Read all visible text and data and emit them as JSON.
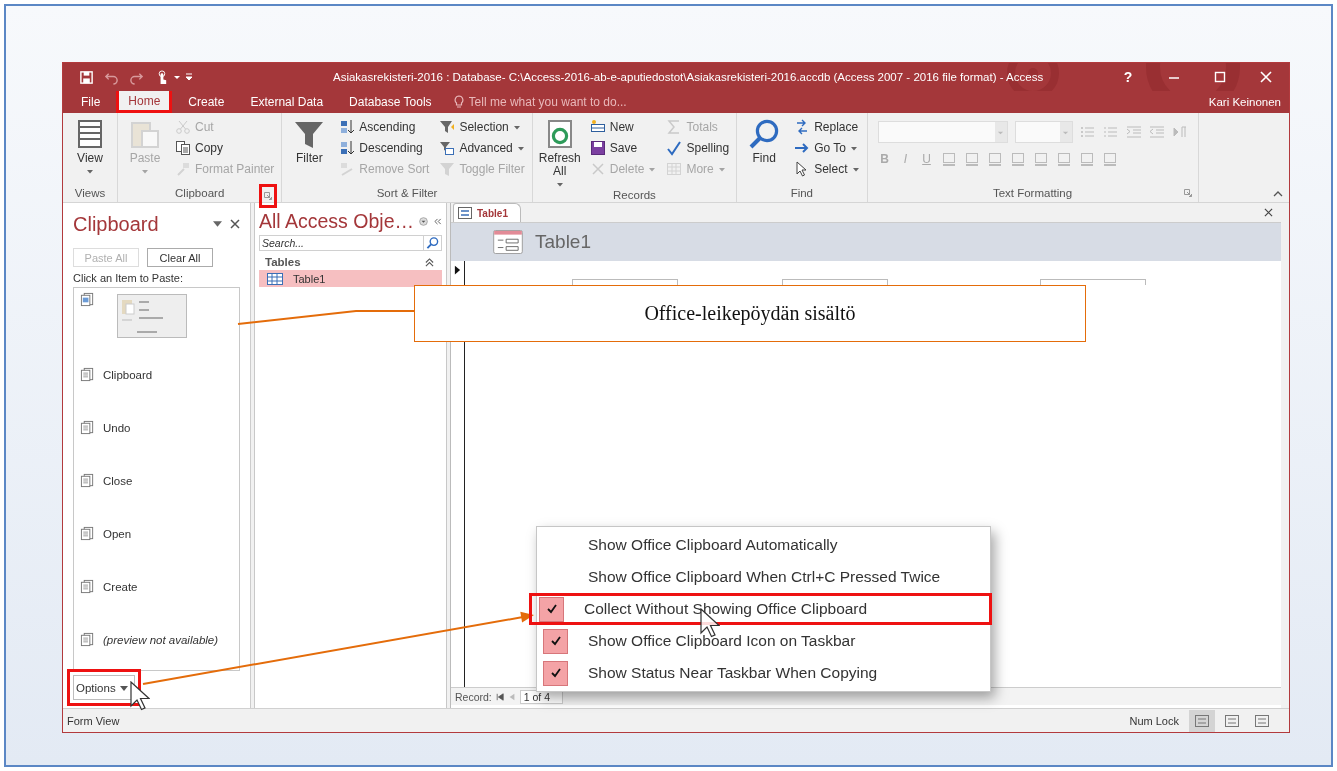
{
  "window": {
    "title": "Asiakasrekisteri-2016 : Database- C:\\Access-2016-ab-e-aputiedostot\\Asiakasrekisteri-2016.accdb (Access 2007 - 2016 file format) - Access",
    "help": "?",
    "user": "Kari Keinonen"
  },
  "ribbon_tabs": [
    {
      "label": "File",
      "selected": false,
      "highlighted": false
    },
    {
      "label": "Home",
      "selected": true,
      "highlighted": true
    },
    {
      "label": "Create",
      "selected": false,
      "highlighted": false
    },
    {
      "label": "External Data",
      "selected": false,
      "highlighted": false
    },
    {
      "label": "Database Tools",
      "selected": false,
      "highlighted": false
    }
  ],
  "tell_me": {
    "placeholder": "Tell me what you want to do..."
  },
  "ribbon_groups": [
    {
      "label": "Views",
      "kind": "commands",
      "columns": [
        [
          {
            "label": "View",
            "kind": "large",
            "dropdown": true,
            "disabled": false
          }
        ]
      ]
    },
    {
      "label": "Clipboard",
      "kind": "commands",
      "launcher": {
        "highlighted": true
      },
      "columns": [
        [
          {
            "label": "Paste",
            "kind": "large",
            "dropdown": true,
            "disabled": true
          }
        ],
        [
          {
            "label": "Cut",
            "kind": "small",
            "dropdown": false,
            "disabled": true
          },
          {
            "label": "Copy",
            "kind": "small",
            "dropdown": false,
            "disabled": false
          },
          {
            "label": "Format Painter",
            "kind": "small",
            "dropdown": false,
            "disabled": true
          }
        ]
      ]
    },
    {
      "label": "Sort & Filter",
      "kind": "commands",
      "columns": [
        [
          {
            "label": "Filter",
            "kind": "large",
            "dropdown": false,
            "disabled": false
          }
        ],
        [
          {
            "label": "Ascending",
            "kind": "small",
            "dropdown": false,
            "disabled": false
          },
          {
            "label": "Descending",
            "kind": "small",
            "dropdown": false,
            "disabled": false
          },
          {
            "label": "Remove Sort",
            "kind": "small",
            "dropdown": false,
            "disabled": true
          }
        ],
        [
          {
            "label": "Selection",
            "kind": "small",
            "dropdown": true,
            "disabled": false
          },
          {
            "label": "Advanced",
            "kind": "small",
            "dropdown": true,
            "disabled": false
          },
          {
            "label": "Toggle Filter",
            "kind": "small",
            "dropdown": false,
            "disabled": true
          }
        ]
      ]
    },
    {
      "label": "Records",
      "kind": "commands",
      "columns": [
        [
          {
            "label": "Refresh All",
            "kind": "large",
            "dropdown": true,
            "disabled": false
          }
        ],
        [
          {
            "label": "New",
            "kind": "small",
            "dropdown": false,
            "disabled": false
          },
          {
            "label": "Save",
            "kind": "small",
            "dropdown": false,
            "disabled": false
          },
          {
            "label": "Delete",
            "kind": "small",
            "dropdown": true,
            "disabled": true
          }
        ],
        [
          {
            "label": "Totals",
            "kind": "small",
            "dropdown": false,
            "disabled": true
          },
          {
            "label": "Spelling",
            "kind": "small",
            "dropdown": false,
            "disabled": false
          },
          {
            "label": "More",
            "kind": "small",
            "dropdown": true,
            "disabled": true
          }
        ]
      ]
    },
    {
      "label": "Find",
      "kind": "commands",
      "columns": [
        [
          {
            "label": "Find",
            "kind": "large",
            "dropdown": false,
            "disabled": false
          }
        ],
        [
          {
            "label": "Replace",
            "kind": "small",
            "dropdown": false,
            "disabled": false
          },
          {
            "label": "Go To",
            "kind": "small",
            "dropdown": true,
            "disabled": false
          },
          {
            "label": "Select",
            "kind": "small",
            "dropdown": true,
            "disabled": false
          }
        ]
      ]
    },
    {
      "label": "Text Formatting",
      "kind": "formatting",
      "launcher": {
        "highlighted": false
      },
      "style_buttons": [
        "B",
        "I",
        "U"
      ]
    }
  ],
  "clipboard_pane": {
    "title": "Clipboard",
    "buttons": [
      {
        "label": "Paste All",
        "disabled": true
      },
      {
        "label": "Clear All",
        "disabled": false
      }
    ],
    "hint": "Click an Item to Paste:",
    "items": [
      {
        "kind": "image"
      },
      {
        "kind": "text",
        "label": "Clipboard",
        "italic": false
      },
      {
        "kind": "text",
        "label": "Undo",
        "italic": false
      },
      {
        "kind": "text",
        "label": "Close",
        "italic": false
      },
      {
        "kind": "text",
        "label": "Open",
        "italic": false
      },
      {
        "kind": "text",
        "label": "Create",
        "italic": false
      },
      {
        "kind": "text",
        "label": "(preview not available)",
        "italic": true
      }
    ],
    "options": {
      "label": "Options",
      "highlighted": true
    }
  },
  "navigation_pane": {
    "title": "All Access Obje…",
    "search": {
      "placeholder": "Search..."
    },
    "groups": [
      {
        "label": "Tables",
        "items": [
          {
            "label": "Table1",
            "selected": true
          }
        ]
      }
    ]
  },
  "document": {
    "tabs": [
      {
        "label": "Table1",
        "selected": true
      }
    ],
    "form_title": "Table1",
    "record_nav": {
      "label": "Record:",
      "position": "1 of 4"
    }
  },
  "status_bar": {
    "view": "Form View",
    "indicators": [
      "Num Lock"
    ],
    "views": [
      {
        "selected": true
      },
      {
        "selected": false
      },
      {
        "selected": false
      }
    ]
  },
  "callout": {
    "text": "Office-leikepöydän sisältö"
  },
  "context_menu": {
    "items": [
      {
        "label": "Show Office Clipboard Automatically",
        "checked": false,
        "highlighted": false
      },
      {
        "label": "Show Office Clipboard When Ctrl+C Pressed Twice",
        "checked": false,
        "highlighted": false
      },
      {
        "label": "Collect Without Showing Office Clipboard",
        "checked": true,
        "highlighted": true
      },
      {
        "label": "Show Office Clipboard Icon on Taskbar",
        "checked": true,
        "highlighted": false
      },
      {
        "label": "Show Status Near Taskbar When Copying",
        "checked": true,
        "highlighted": false
      }
    ]
  }
}
